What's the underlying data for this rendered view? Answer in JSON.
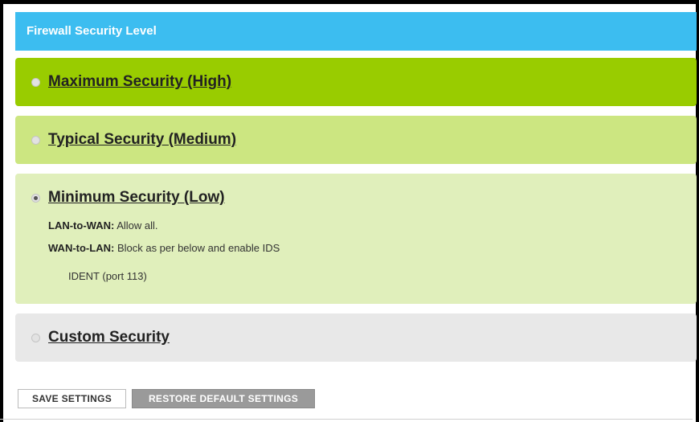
{
  "header": {
    "title": "Firewall Security Level"
  },
  "options": [
    {
      "label": "Maximum Security (High)",
      "selected": false,
      "color": "#99cc00"
    },
    {
      "label": "Typical Security (Medium)",
      "selected": false,
      "color": "#cce681"
    },
    {
      "label": "Minimum Security (Low)",
      "selected": true,
      "color": "#e0efbb",
      "details": {
        "lan_to_wan_key": "LAN-to-WAN:",
        "lan_to_wan_value": "Allow all.",
        "wan_to_lan_key": "WAN-to-LAN:",
        "wan_to_lan_value": "Block as per below and enable IDS",
        "ident": "IDENT (port 113)"
      }
    },
    {
      "label": "Custom Security",
      "selected": false,
      "color": "#e8e8e8"
    }
  ],
  "buttons": {
    "save": "SAVE SETTINGS",
    "restore": "RESTORE DEFAULT SETTINGS"
  },
  "colors": {
    "header": "#3cbdf0",
    "restore_button": "#9a9a9a"
  }
}
